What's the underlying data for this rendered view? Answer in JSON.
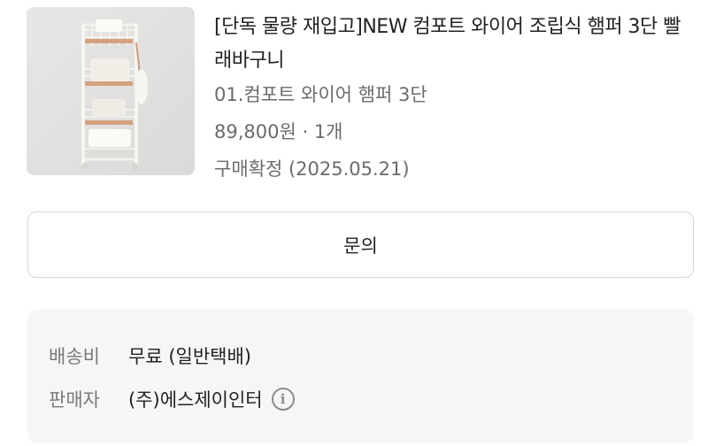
{
  "product": {
    "title": "[단독 물량 재입고]NEW 컴포트 와이어 조립식 햄퍼 3단 빨래바구니",
    "option": "01.컴포트 와이어 햄퍼 3단",
    "price_qty": "89,800원 · 1개",
    "status": "구매확정 (2025.05.21)",
    "thumbnail_icon": "product-thumbnail"
  },
  "inquiry": {
    "label": "문의"
  },
  "shipping": {
    "fee_label": "배송비",
    "fee_value": "무료 (일반택배)",
    "seller_label": "판매자",
    "seller_value": "(주)에스제이인터",
    "info_icon": "ⓘ"
  }
}
